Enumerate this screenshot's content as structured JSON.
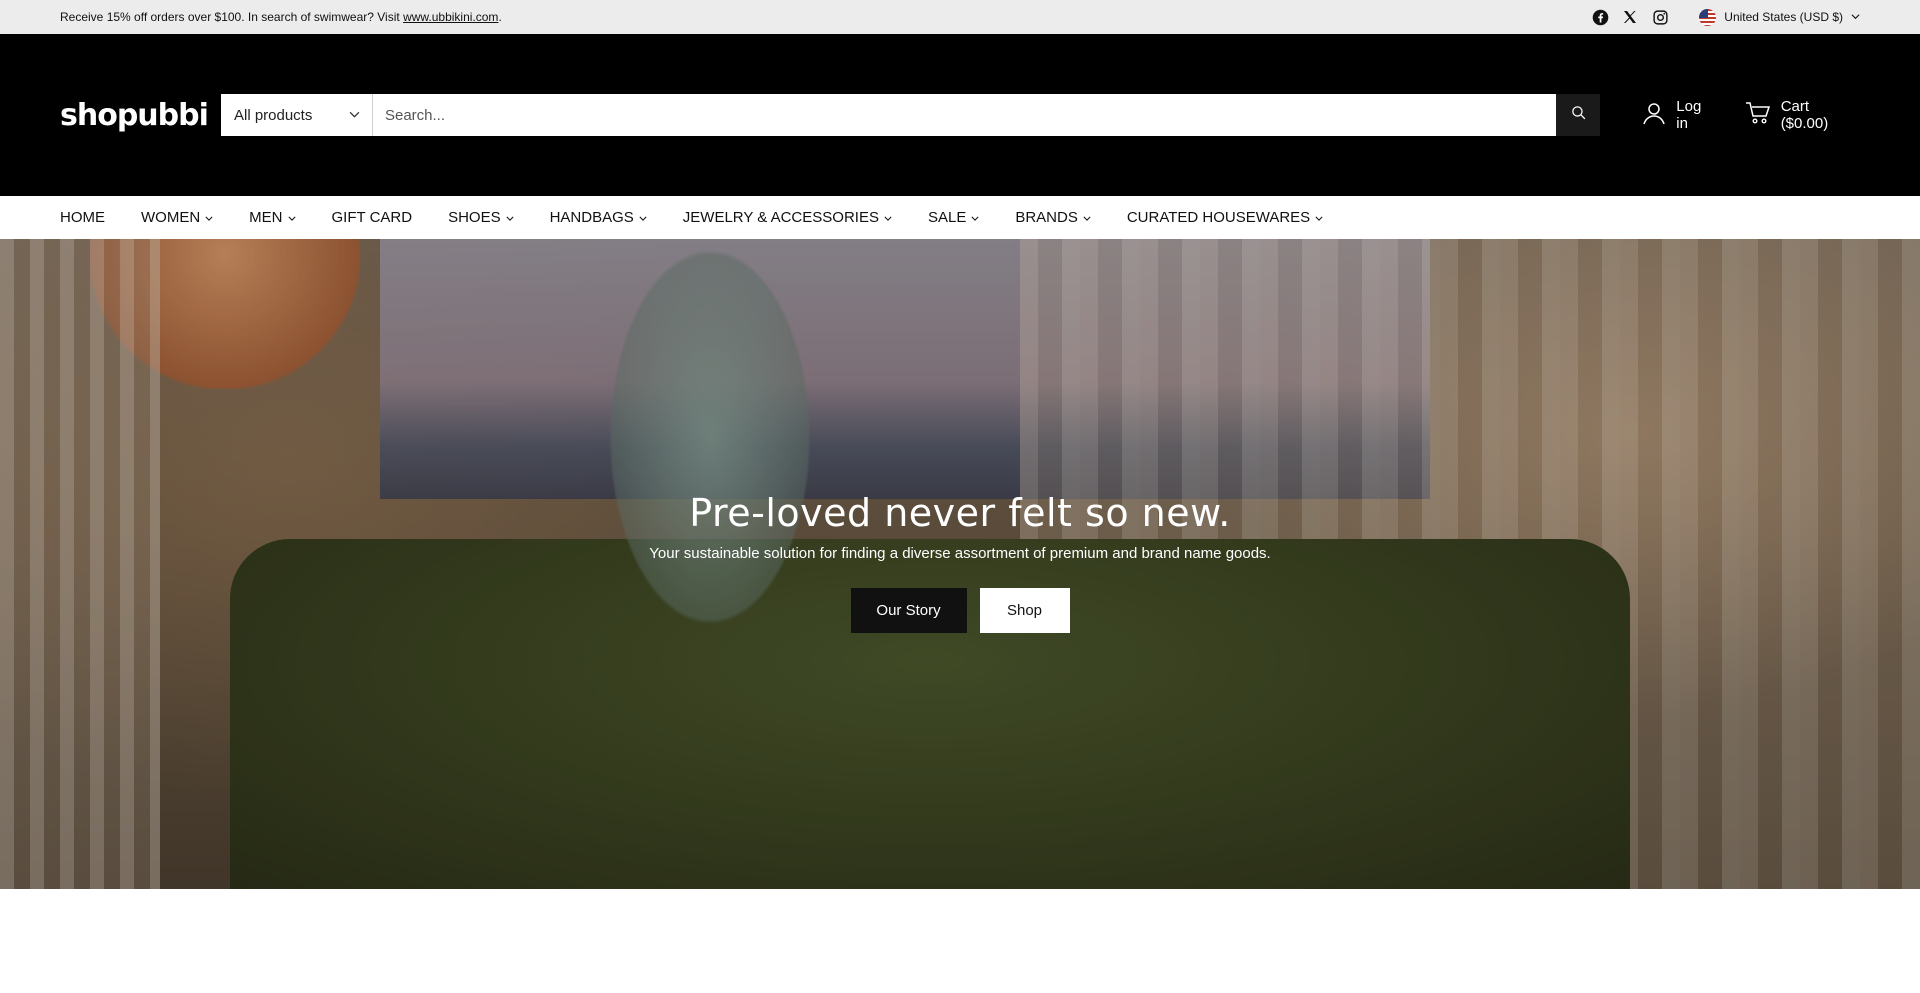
{
  "announcement": {
    "text": "Receive 15% off orders over $100. In search of swimwear? Visit ",
    "link": "www.ubbikini.com",
    "suffix": "."
  },
  "social": [
    "facebook-icon",
    "x-icon",
    "instagram-icon"
  ],
  "locale": {
    "label": "United States (USD $)"
  },
  "header": {
    "logo": "shopubbi",
    "category_select": "All products",
    "search_placeholder": "Search...",
    "login": "Log in",
    "cart": "Cart ($0.00)"
  },
  "nav": {
    "items": [
      {
        "label": "HOME",
        "dropdown": false
      },
      {
        "label": "WOMEN",
        "dropdown": true
      },
      {
        "label": "MEN",
        "dropdown": true
      },
      {
        "label": "GIFT CARD",
        "dropdown": false
      },
      {
        "label": "SHOES",
        "dropdown": true
      },
      {
        "label": "HANDBAGS",
        "dropdown": true
      },
      {
        "label": "JEWELRY & ACCESSORIES",
        "dropdown": true
      },
      {
        "label": "SALE",
        "dropdown": true
      },
      {
        "label": "BRANDS",
        "dropdown": true
      },
      {
        "label": "CURATED HOUSEWARES",
        "dropdown": true
      }
    ]
  },
  "hero": {
    "title": "Pre-loved never felt so new.",
    "subtitle": "Your sustainable solution for finding a diverse assortment of premium and brand name goods.",
    "primary_button": "Our Story",
    "secondary_button": "Shop"
  },
  "colors": {
    "header_bg": "#000000",
    "announcement_bg": "#ececec",
    "button_dark": "#111111",
    "button_light": "#ffffff"
  }
}
